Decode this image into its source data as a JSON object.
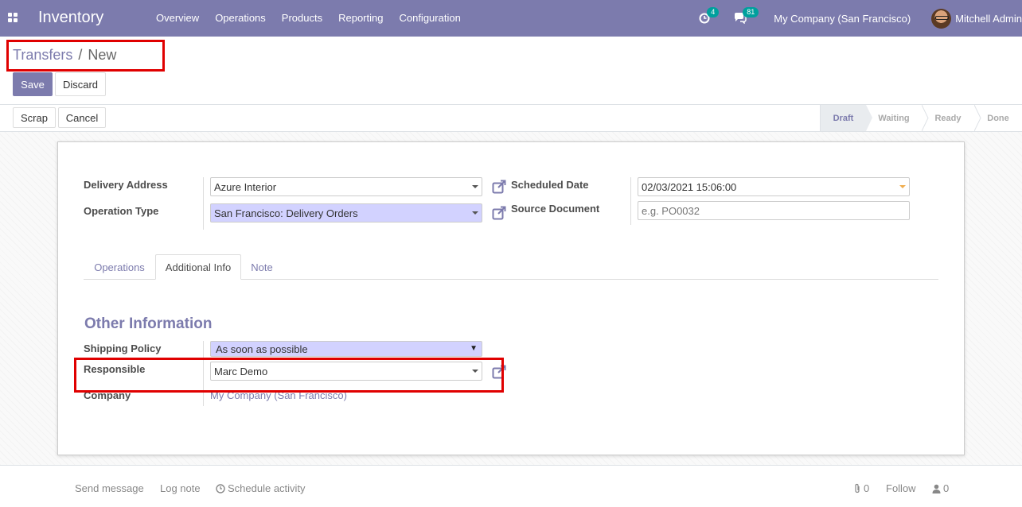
{
  "navbar": {
    "app_name": "Inventory",
    "menu": [
      "Overview",
      "Operations",
      "Products",
      "Reporting",
      "Configuration"
    ],
    "activity_count": "4",
    "message_count": "81",
    "company": "My Company (San Francisco)",
    "user": "Mitchell Admin"
  },
  "breadcrumb": {
    "parent": "Transfers",
    "separator": "/",
    "current": "New"
  },
  "actions": {
    "save": "Save",
    "discard": "Discard"
  },
  "header_buttons": {
    "scrap": "Scrap",
    "cancel": "Cancel"
  },
  "status_steps": [
    {
      "label": "Draft",
      "active": true
    },
    {
      "label": "Waiting",
      "active": false
    },
    {
      "label": "Ready",
      "active": false
    },
    {
      "label": "Done",
      "active": false
    }
  ],
  "form": {
    "delivery_address_label": "Delivery Address",
    "delivery_address_value": "Azure Interior",
    "operation_type_label": "Operation Type",
    "operation_type_value": "San Francisco: Delivery Orders",
    "scheduled_date_label": "Scheduled Date",
    "scheduled_date_value": "02/03/2021 15:06:00",
    "source_document_label": "Source Document",
    "source_document_placeholder": "e.g. PO0032"
  },
  "tabs": [
    {
      "label": "Operations",
      "active": false
    },
    {
      "label": "Additional Info",
      "active": true
    },
    {
      "label": "Note",
      "active": false
    }
  ],
  "additional_info": {
    "section_title": "Other Information",
    "shipping_policy_label": "Shipping Policy",
    "shipping_policy_value": "As soon as possible",
    "responsible_label": "Responsible",
    "responsible_value": "Marc Demo",
    "company_label": "Company",
    "company_value": "My Company (San Francisco)"
  },
  "chatter": {
    "send_message": "Send message",
    "log_note": "Log note",
    "schedule_activity": "Schedule activity",
    "attachments_count": "0",
    "follow": "Follow",
    "followers_count": "0"
  },
  "colors": {
    "navbar": "#7c7bad",
    "accent": "#7c7bad",
    "required_field": "#d2d2ff",
    "highlight": "#e00000",
    "badge": "#00a09d"
  }
}
